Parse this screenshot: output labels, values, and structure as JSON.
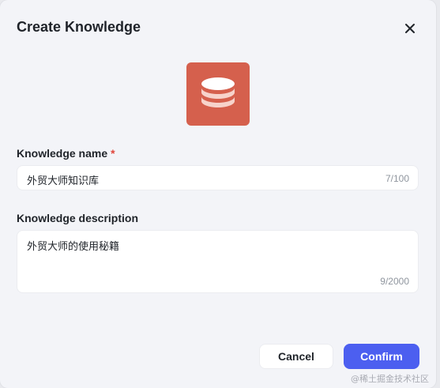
{
  "dialog": {
    "title": "Create Knowledge",
    "icon": "database-icon",
    "icon_bg_color": "#d5604d"
  },
  "name_field": {
    "label": "Knowledge name",
    "required_mark": "*",
    "value": "外贸大师知识库",
    "counter": "7/100"
  },
  "description_field": {
    "label": "Knowledge description",
    "value": "外贸大师的使用秘籍",
    "counter": "9/2000"
  },
  "buttons": {
    "cancel": "Cancel",
    "confirm": "Confirm",
    "confirm_color": "#4c5ff0"
  },
  "watermark": "@稀土掘金技术社区"
}
